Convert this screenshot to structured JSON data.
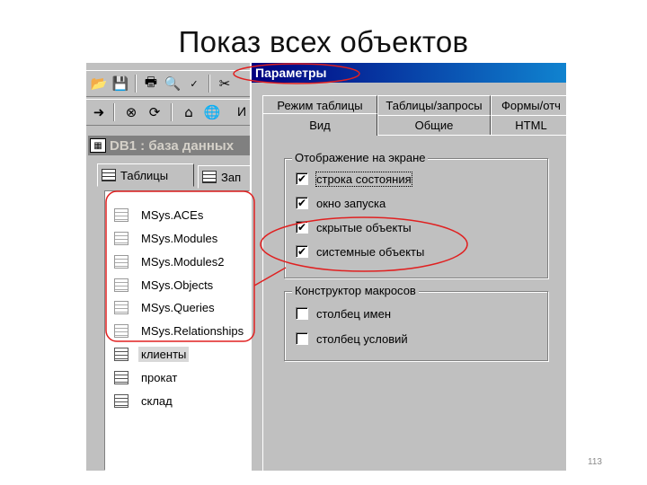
{
  "slide": {
    "title": "Показ всех объектов",
    "page_number": "113"
  },
  "database_window": {
    "title": "DB1 : база данных",
    "tabs": [
      {
        "label": "Таблицы",
        "active": true
      },
      {
        "label": "Зап"
      }
    ],
    "tables": [
      {
        "name": "MSys.ACEs",
        "system": true
      },
      {
        "name": "MSys.Modules",
        "system": true
      },
      {
        "name": "MSys.Modules2",
        "system": true
      },
      {
        "name": "MSys.Objects",
        "system": true
      },
      {
        "name": "MSys.Queries",
        "system": true
      },
      {
        "name": "MSys.Relationships",
        "system": true
      },
      {
        "name": "клиенты",
        "system": false,
        "selected": true
      },
      {
        "name": "прокат",
        "system": false
      },
      {
        "name": "склад",
        "system": false
      }
    ]
  },
  "toolbar": {
    "letter": "И"
  },
  "options_dialog": {
    "title": "Параметры",
    "tabs_back": [
      "Режим таблицы",
      "Таблицы/запросы",
      "Формы/отч"
    ],
    "tabs_front": [
      "Вид",
      "Общие",
      "HTML"
    ],
    "active_tab": "Вид",
    "display_group": {
      "legend": "Отображение на экране",
      "options": [
        {
          "label": "строка состояния",
          "checked": true
        },
        {
          "label": "окно запуска",
          "checked": true
        },
        {
          "label": "скрытые объекты",
          "checked": true
        },
        {
          "label": "системные объекты",
          "checked": true
        }
      ]
    },
    "macro_group": {
      "legend": "Конструктор макросов",
      "options": [
        {
          "label": "столбец имен",
          "checked": false
        },
        {
          "label": "столбец условий",
          "checked": false
        }
      ]
    }
  },
  "colors": {
    "annotation": "#e02020",
    "titlebar": "#000080",
    "face": "#c0c0c0"
  }
}
